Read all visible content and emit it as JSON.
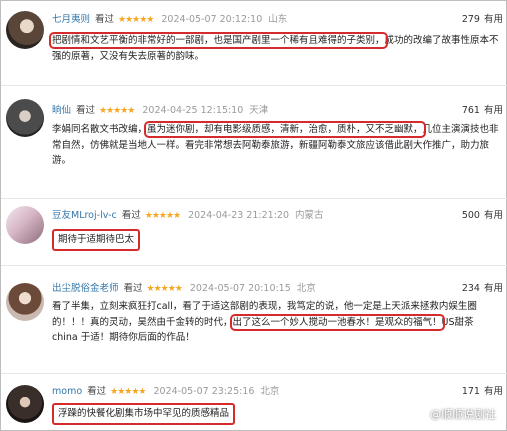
{
  "reviews": [
    {
      "username": "七月夷则",
      "seen_label": "看过",
      "stars": "★★★★★",
      "date": "2024-05-07 20:12:10",
      "location": "山东",
      "useful_count": "279",
      "useful_label": "有用",
      "highlight": "把剧情和文艺平衡的非常好的一部剧，也是国产剧里一个稀有且难得的子类别，",
      "rest": "成功的改编了故事性原本不强的原著，又没有失去原著的韵味。"
    },
    {
      "username": "晌仙",
      "seen_label": "看过",
      "stars": "★★★★★",
      "date": "2024-04-25 12:15:10",
      "location": "天津",
      "useful_count": "761",
      "useful_label": "有用",
      "before": "李娟同名散文书改编，",
      "highlight": "虽为迷你剧，却有电影级质感，清新，治愈，质朴，又不乏幽默，",
      "rest": "几位主演演技也非常自然，仿佛就是当地人一样。看完非常想去阿勒泰旅游，新疆阿勒泰文旅应该借此剧大作推广，助力旅游。"
    },
    {
      "username": "豆友MLroj-lv-c",
      "seen_label": "看过",
      "stars": "★★★★★",
      "date": "2024-04-23 21:21:20",
      "location": "内蒙古",
      "useful_count": "500",
      "useful_label": "有用",
      "highlight": "期待于适期待巴太"
    },
    {
      "username": "出尘脱俗金老师",
      "seen_label": "看过",
      "stars": "★★★★★",
      "date": "2024-05-07 20:10:15",
      "location": "北京",
      "useful_count": "234",
      "useful_label": "有用",
      "before": "看了半集，立刻来疯狂打call，看了于适这部剧的表现，我笃定的说，他一定是上天派来拯救内娱生圈的！！！真的灵动，昊然由千金转的时代，",
      "highlight": "出了这么一个妙人搅动一池春水！是观众的福气！",
      "rest": "US甜茶 china 于适！期待你后面的作品！"
    },
    {
      "username": "momo",
      "seen_label": "看过",
      "stars": "★★★★★",
      "date": "2024-05-07 23:25:16",
      "location": "北京",
      "useful_count": "171",
      "useful_label": "有用",
      "highlight": "浮躁的快餐化剧集市场中罕见的质感精品"
    }
  ],
  "watermark": "@顺顺说剧社"
}
